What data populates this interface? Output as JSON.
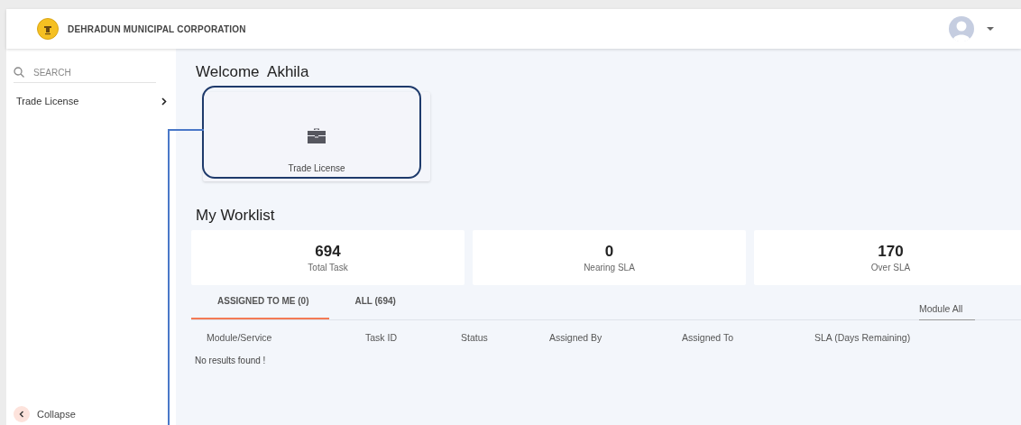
{
  "header": {
    "title": "DEHRADUN MUNICIPAL CORPORATION"
  },
  "sidebar": {
    "search": {
      "placeholder": "SEARCH"
    },
    "items": [
      {
        "label": "Trade License"
      }
    ],
    "collapse": "Collapse"
  },
  "welcome": "Welcome  Akhila",
  "modules": [
    {
      "label": "Trade License",
      "highlighted": true
    }
  ],
  "worklist": {
    "title": "My Worklist",
    "stats": [
      {
        "value": "694",
        "label": "Total Task"
      },
      {
        "value": "0",
        "label": "Nearing SLA"
      },
      {
        "value": "170",
        "label": "Over SLA"
      }
    ],
    "tabs": [
      {
        "label": "ASSIGNED TO ME (0)",
        "selected": true
      },
      {
        "label": "ALL (694)",
        "selected": false
      }
    ],
    "module_filter": "Module All",
    "columns": [
      "Module/Service",
      "Task ID",
      "Status",
      "Assigned By",
      "Assigned To",
      "SLA (Days Remaining)"
    ],
    "empty_message": "No results found !"
  }
}
